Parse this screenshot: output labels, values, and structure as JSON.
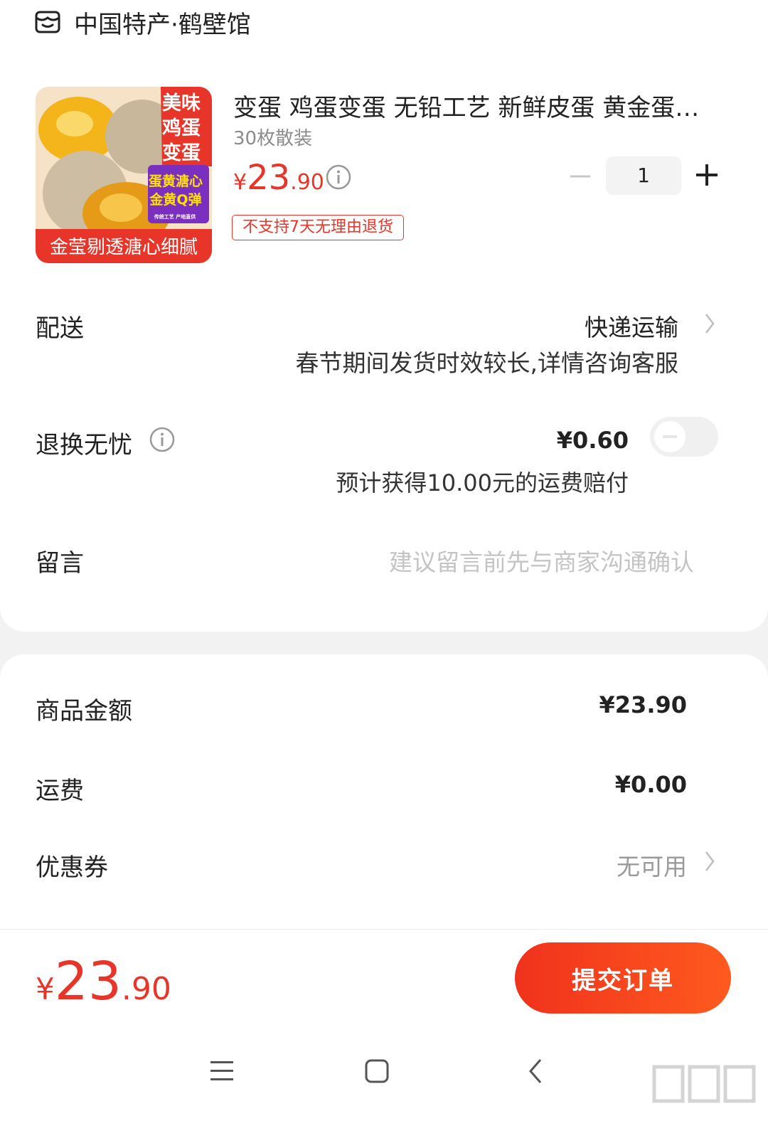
{
  "store": {
    "name": "中国特产·鹤壁馆",
    "icon": "store-icon"
  },
  "product": {
    "image_text": {
      "top": "美味鸡蛋变蛋",
      "mid": "蛋黄溏心金黄Q弹",
      "tiny": "传统工艺 产地直供",
      "bottom": "金莹剔透溏心细腻"
    },
    "title": "变蛋 鸡蛋变蛋 无铅工艺 新鲜皮蛋 黄金蛋…",
    "spec": "30枚散装",
    "price": {
      "currency": "¥",
      "integer": "23",
      "decimal": ".90"
    },
    "quantity": "1",
    "tag": "不支持7天无理由退货"
  },
  "delivery": {
    "label": "配送",
    "method": "快递运输",
    "note": "春节期间发货时效较长,详情咨询客服"
  },
  "return_service": {
    "label": "退换无忧",
    "price": "¥0.60",
    "note": "预计获得10.00元的运费赔付",
    "enabled": false
  },
  "message": {
    "label": "留言",
    "placeholder": "建议留言前先与商家沟通确认"
  },
  "summary": {
    "goods_label": "商品金额",
    "goods_value": "¥23.90",
    "shipping_label": "运费",
    "shipping_value": "¥0.00",
    "coupon_label": "优惠券",
    "coupon_value": "无可用"
  },
  "footer": {
    "currency": "¥",
    "integer": "23",
    "decimal": ".90",
    "submit_label": "提交订单"
  },
  "colors": {
    "accent": "#e8352a",
    "submit_gradient_start": "#f0321d",
    "submit_gradient_end": "#ff5a1e"
  }
}
